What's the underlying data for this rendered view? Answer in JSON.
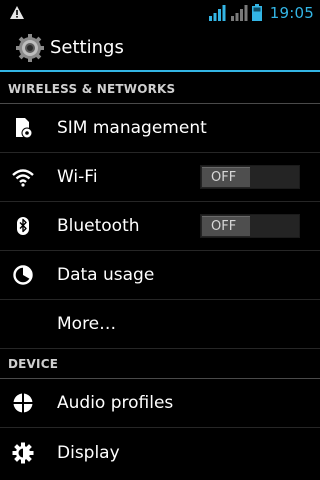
{
  "status_bar": {
    "warning_icon": "warning-triangle-icon",
    "signal_icons": [
      "signal-sim1-icon",
      "signal-sim2-icon"
    ],
    "battery_icon": "battery-icon",
    "time": "19:05",
    "time_color": "#33b5e5"
  },
  "action_bar": {
    "icon": "settings-gear-icon",
    "title": "Settings",
    "accent_color": "#33b5e5"
  },
  "sections": {
    "wireless": {
      "header": "WIRELESS & NETWORKS",
      "sim": {
        "icon": "sim-card-icon",
        "label": "SIM management"
      },
      "wifi": {
        "icon": "wifi-icon",
        "label": "Wi-Fi",
        "toggle": "OFF"
      },
      "bluetooth": {
        "icon": "bluetooth-icon",
        "label": "Bluetooth",
        "toggle": "OFF"
      },
      "data_usage": {
        "icon": "data-usage-icon",
        "label": "Data usage"
      },
      "more": {
        "label": "More…"
      }
    },
    "device": {
      "header": "DEVICE",
      "audio": {
        "icon": "audio-profiles-icon",
        "label": "Audio profiles"
      },
      "display": {
        "icon": "display-brightness-icon",
        "label": "Display"
      }
    }
  }
}
